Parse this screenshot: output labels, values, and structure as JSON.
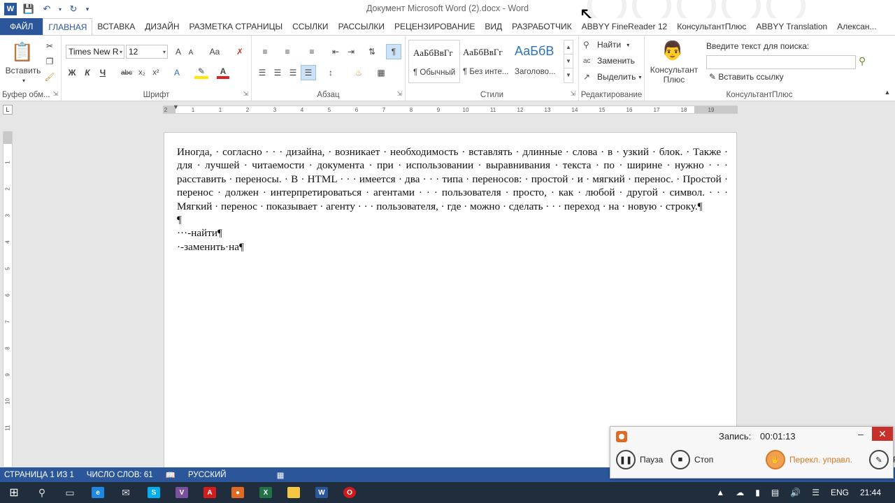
{
  "window": {
    "title": "Документ Microsoft Word (2).docx - Word"
  },
  "qat": {
    "undo_icon": "undo-icon",
    "redo_icon": "repeat-icon",
    "save_icon": "save-icon"
  },
  "tabs": [
    {
      "label": "ФАЙЛ"
    },
    {
      "label": "ГЛАВНАЯ"
    },
    {
      "label": "ВСТАВКА"
    },
    {
      "label": "ДИЗАЙН"
    },
    {
      "label": "РАЗМЕТКА СТРАНИЦЫ"
    },
    {
      "label": "ССЫЛКИ"
    },
    {
      "label": "РАССЫЛКИ"
    },
    {
      "label": "РЕЦЕНЗИРОВАНИЕ"
    },
    {
      "label": "ВИД"
    },
    {
      "label": "РАЗРАБОТЧИК"
    },
    {
      "label": "ABBYY FineReader 12"
    },
    {
      "label": "КонсультантПлюс"
    },
    {
      "label": "ABBYY Translation"
    },
    {
      "label": "Алексан..."
    }
  ],
  "ribbon": {
    "clipboard": {
      "paste_label": "Вставить",
      "group_label": "Буфер обм..."
    },
    "font": {
      "font_name": "Times New R",
      "font_size": "12",
      "bold": "Ж",
      "italic": "К",
      "underline": "Ч",
      "strike": "abc",
      "subscript": "x₂",
      "superscript": "x²",
      "case": "Aa",
      "grow": "A",
      "shrink": "A",
      "text_effects": "A",
      "font_color": "A",
      "group_label": "Шрифт"
    },
    "paragraph": {
      "group_label": "Абзац",
      "show_marks": "¶"
    },
    "styles": {
      "items": [
        {
          "sample": "АаБбВвГг",
          "name": "¶ Обычный"
        },
        {
          "sample": "АаБбВвГг",
          "name": "¶ Без инте..."
        },
        {
          "sample": "АаБбВ",
          "name": "Заголово..."
        }
      ],
      "group_label": "Стили"
    },
    "editing": {
      "find": "Найти",
      "replace": "Заменить",
      "select": "Выделить",
      "group_label": "Редактирование"
    },
    "consultant": {
      "button_label": "Консультант Плюс",
      "search_label": "Введите текст для поиска:",
      "search_value": "",
      "insert_link": "Вставить ссылку",
      "group_label": "КонсультантПлюс"
    }
  },
  "ruler": {
    "marks": [
      "2",
      "1",
      "1",
      "2",
      "3",
      "4",
      "5",
      "6",
      "7",
      "8",
      "9",
      "10",
      "11",
      "12",
      "13",
      "14",
      "15",
      "16",
      "17",
      "18",
      "19"
    ]
  },
  "vruler": {
    "marks": [
      "1",
      "2",
      "3",
      "4",
      "5",
      "6",
      "7",
      "8",
      "9",
      "10",
      "11"
    ]
  },
  "document": {
    "paragraphs": [
      "Иногда, · согласно · · · дизайна, · возникает · необходимость · вставлять · длинные · слова · в · узкий · блок. · Также · для · лучшей · читаемости · документа · при · использовании · выравнивания · текста · по · ширине · нужно · · · расставить · переносы. · В · HTML · · · имеется · два · · · типа · переносов: · простой · и · мягкий · перенос. · Простой · перенос · должен · интерпретироваться · агентами · · · пользователя · просто, · как · любой · другой · символ. · · · Мягкий · перенос · показывает · агенту · · · пользователя, · где · можно · сделать · · · переход · на · новую · строку.¶",
      "¶",
      "···-найти¶",
      "·-заменить·на¶"
    ]
  },
  "statusbar": {
    "page": "СТРАНИЦА 1 ИЗ 1",
    "words": "ЧИСЛО СЛОВ: 61",
    "language": "РУССКИЙ"
  },
  "recorder": {
    "label": "Запись:",
    "time": "00:01:13",
    "pause": "Пауза",
    "stop": "Стоп",
    "switch": "Перекл. управл.",
    "draw": "Ри"
  },
  "taskbar": {
    "lang": "ENG",
    "clock": "21:44"
  },
  "colors": {
    "accent": "#2b579a",
    "record_orange": "#e06a23",
    "close_red": "#c8312b"
  }
}
